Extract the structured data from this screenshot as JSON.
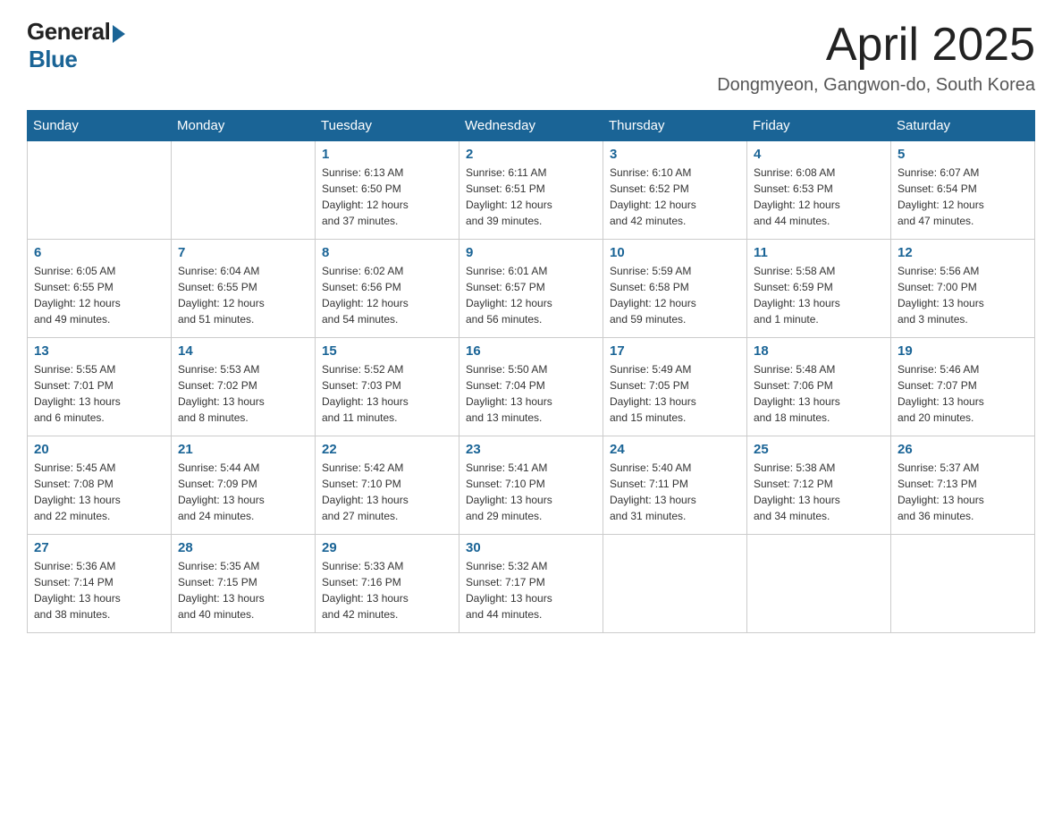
{
  "logo": {
    "general": "General",
    "blue": "Blue"
  },
  "title": "April 2025",
  "subtitle": "Dongmyeon, Gangwon-do, South Korea",
  "weekdays": [
    "Sunday",
    "Monday",
    "Tuesday",
    "Wednesday",
    "Thursday",
    "Friday",
    "Saturday"
  ],
  "weeks": [
    [
      {
        "day": "",
        "info": ""
      },
      {
        "day": "",
        "info": ""
      },
      {
        "day": "1",
        "info": "Sunrise: 6:13 AM\nSunset: 6:50 PM\nDaylight: 12 hours\nand 37 minutes."
      },
      {
        "day": "2",
        "info": "Sunrise: 6:11 AM\nSunset: 6:51 PM\nDaylight: 12 hours\nand 39 minutes."
      },
      {
        "day": "3",
        "info": "Sunrise: 6:10 AM\nSunset: 6:52 PM\nDaylight: 12 hours\nand 42 minutes."
      },
      {
        "day": "4",
        "info": "Sunrise: 6:08 AM\nSunset: 6:53 PM\nDaylight: 12 hours\nand 44 minutes."
      },
      {
        "day": "5",
        "info": "Sunrise: 6:07 AM\nSunset: 6:54 PM\nDaylight: 12 hours\nand 47 minutes."
      }
    ],
    [
      {
        "day": "6",
        "info": "Sunrise: 6:05 AM\nSunset: 6:55 PM\nDaylight: 12 hours\nand 49 minutes."
      },
      {
        "day": "7",
        "info": "Sunrise: 6:04 AM\nSunset: 6:55 PM\nDaylight: 12 hours\nand 51 minutes."
      },
      {
        "day": "8",
        "info": "Sunrise: 6:02 AM\nSunset: 6:56 PM\nDaylight: 12 hours\nand 54 minutes."
      },
      {
        "day": "9",
        "info": "Sunrise: 6:01 AM\nSunset: 6:57 PM\nDaylight: 12 hours\nand 56 minutes."
      },
      {
        "day": "10",
        "info": "Sunrise: 5:59 AM\nSunset: 6:58 PM\nDaylight: 12 hours\nand 59 minutes."
      },
      {
        "day": "11",
        "info": "Sunrise: 5:58 AM\nSunset: 6:59 PM\nDaylight: 13 hours\nand 1 minute."
      },
      {
        "day": "12",
        "info": "Sunrise: 5:56 AM\nSunset: 7:00 PM\nDaylight: 13 hours\nand 3 minutes."
      }
    ],
    [
      {
        "day": "13",
        "info": "Sunrise: 5:55 AM\nSunset: 7:01 PM\nDaylight: 13 hours\nand 6 minutes."
      },
      {
        "day": "14",
        "info": "Sunrise: 5:53 AM\nSunset: 7:02 PM\nDaylight: 13 hours\nand 8 minutes."
      },
      {
        "day": "15",
        "info": "Sunrise: 5:52 AM\nSunset: 7:03 PM\nDaylight: 13 hours\nand 11 minutes."
      },
      {
        "day": "16",
        "info": "Sunrise: 5:50 AM\nSunset: 7:04 PM\nDaylight: 13 hours\nand 13 minutes."
      },
      {
        "day": "17",
        "info": "Sunrise: 5:49 AM\nSunset: 7:05 PM\nDaylight: 13 hours\nand 15 minutes."
      },
      {
        "day": "18",
        "info": "Sunrise: 5:48 AM\nSunset: 7:06 PM\nDaylight: 13 hours\nand 18 minutes."
      },
      {
        "day": "19",
        "info": "Sunrise: 5:46 AM\nSunset: 7:07 PM\nDaylight: 13 hours\nand 20 minutes."
      }
    ],
    [
      {
        "day": "20",
        "info": "Sunrise: 5:45 AM\nSunset: 7:08 PM\nDaylight: 13 hours\nand 22 minutes."
      },
      {
        "day": "21",
        "info": "Sunrise: 5:44 AM\nSunset: 7:09 PM\nDaylight: 13 hours\nand 24 minutes."
      },
      {
        "day": "22",
        "info": "Sunrise: 5:42 AM\nSunset: 7:10 PM\nDaylight: 13 hours\nand 27 minutes."
      },
      {
        "day": "23",
        "info": "Sunrise: 5:41 AM\nSunset: 7:10 PM\nDaylight: 13 hours\nand 29 minutes."
      },
      {
        "day": "24",
        "info": "Sunrise: 5:40 AM\nSunset: 7:11 PM\nDaylight: 13 hours\nand 31 minutes."
      },
      {
        "day": "25",
        "info": "Sunrise: 5:38 AM\nSunset: 7:12 PM\nDaylight: 13 hours\nand 34 minutes."
      },
      {
        "day": "26",
        "info": "Sunrise: 5:37 AM\nSunset: 7:13 PM\nDaylight: 13 hours\nand 36 minutes."
      }
    ],
    [
      {
        "day": "27",
        "info": "Sunrise: 5:36 AM\nSunset: 7:14 PM\nDaylight: 13 hours\nand 38 minutes."
      },
      {
        "day": "28",
        "info": "Sunrise: 5:35 AM\nSunset: 7:15 PM\nDaylight: 13 hours\nand 40 minutes."
      },
      {
        "day": "29",
        "info": "Sunrise: 5:33 AM\nSunset: 7:16 PM\nDaylight: 13 hours\nand 42 minutes."
      },
      {
        "day": "30",
        "info": "Sunrise: 5:32 AM\nSunset: 7:17 PM\nDaylight: 13 hours\nand 44 minutes."
      },
      {
        "day": "",
        "info": ""
      },
      {
        "day": "",
        "info": ""
      },
      {
        "day": "",
        "info": ""
      }
    ]
  ]
}
